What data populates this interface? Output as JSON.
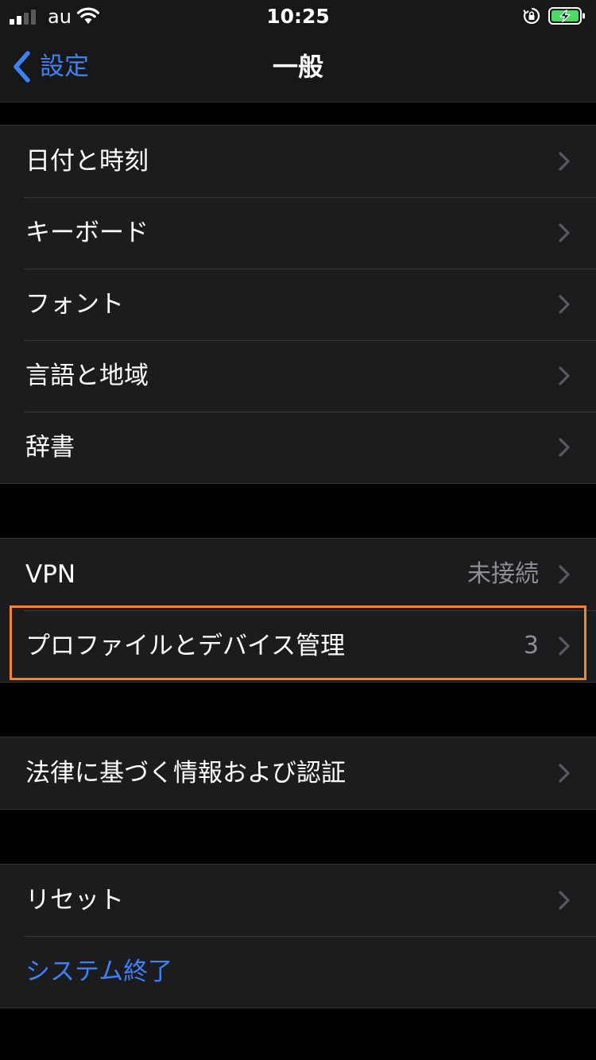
{
  "status_bar": {
    "carrier": "au",
    "time": "10:25",
    "signal_bars": 4,
    "signal_active": 2,
    "icons": [
      "signal-icon",
      "wifi-icon",
      "orientation-lock-icon",
      "battery-charging-icon"
    ],
    "battery_color": "#4cd964"
  },
  "nav": {
    "back_label": "設定",
    "title": "一般"
  },
  "groups": [
    {
      "rows": [
        {
          "label": "日付と時刻",
          "value": ""
        },
        {
          "label": "キーボード",
          "value": ""
        },
        {
          "label": "フォント",
          "value": ""
        },
        {
          "label": "言語と地域",
          "value": ""
        },
        {
          "label": "辞書",
          "value": ""
        }
      ]
    },
    {
      "rows": [
        {
          "label": "VPN",
          "value": "未接続"
        },
        {
          "label": "プロファイルとデバイス管理",
          "value": "3",
          "highlighted": true
        }
      ]
    },
    {
      "rows": [
        {
          "label": "法律に基づく情報および認証",
          "value": ""
        }
      ]
    },
    {
      "rows": [
        {
          "label": "リセット",
          "value": ""
        },
        {
          "label": "システム終了",
          "value": "",
          "link": true
        }
      ]
    }
  ],
  "colors": {
    "background": "#000000",
    "cell": "#1c1c1e",
    "accent": "#3b82f6",
    "highlight": "#f08536",
    "secondary_text": "#8e8e93"
  }
}
